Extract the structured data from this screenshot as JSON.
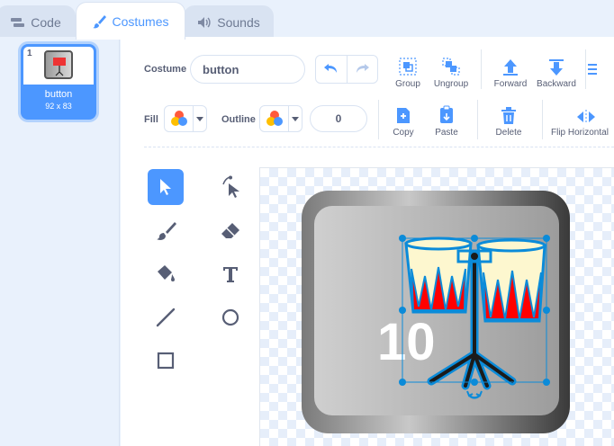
{
  "tabs": [
    {
      "label": "Code"
    },
    {
      "label": "Costumes"
    },
    {
      "label": "Sounds"
    }
  ],
  "costume_list": [
    {
      "number": "1",
      "name": "button",
      "size": "92 x 83"
    }
  ],
  "editor": {
    "costume_label": "Costume",
    "costume_name": "button",
    "fill_label": "Fill",
    "outline_label": "Outline",
    "outline_width": "0",
    "buttons": {
      "group": "Group",
      "ungroup": "Ungroup",
      "forward": "Forward",
      "backward": "Backward",
      "copy": "Copy",
      "paste": "Paste",
      "delete": "Delete",
      "flip_horizontal": "Flip Horizontal"
    }
  },
  "canvas": {
    "costume_text": "10"
  },
  "colors": {
    "accent": "#4c97ff",
    "drum_red": "#ff0000",
    "drum_cream": "#fdf7cf",
    "selection": "#0b8bd9"
  }
}
